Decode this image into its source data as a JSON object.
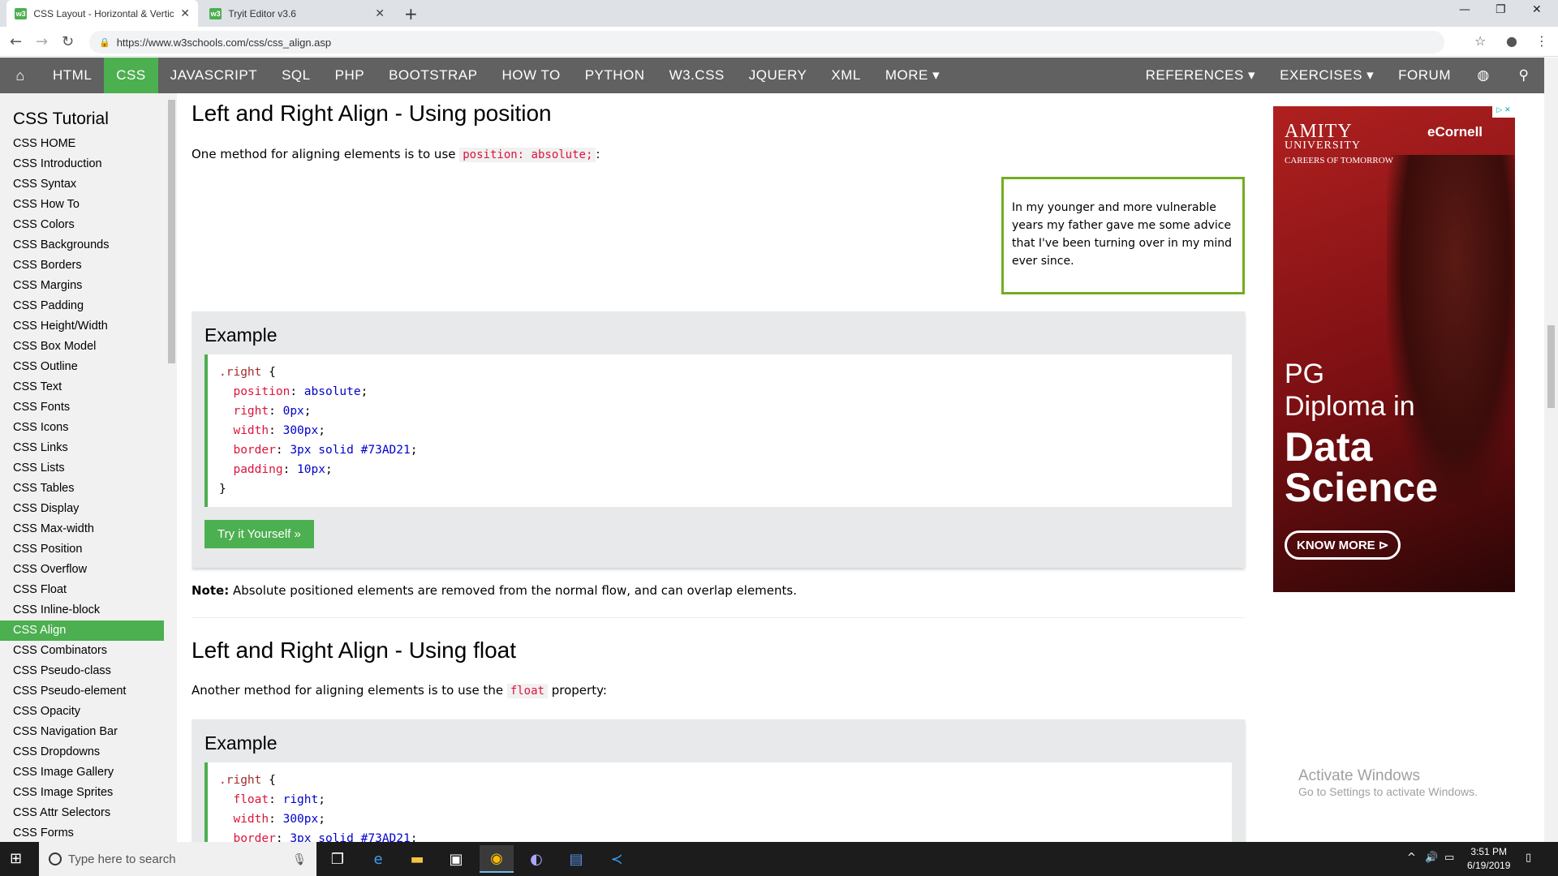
{
  "browser": {
    "tabs": [
      {
        "favicon": "w3",
        "title": "CSS Layout - Horizontal & Vertic",
        "active": true
      },
      {
        "favicon": "w3",
        "title": "Tryit Editor v3.6",
        "active": false
      }
    ],
    "url": "https://www.w3schools.com/css/css_align.asp"
  },
  "topnav": {
    "items": [
      "HTML",
      "CSS",
      "JAVASCRIPT",
      "SQL",
      "PHP",
      "BOOTSTRAP",
      "HOW TO",
      "PYTHON",
      "W3.CSS",
      "JQUERY",
      "XML",
      "MORE ▾"
    ],
    "right_items": [
      "REFERENCES ▾",
      "EXERCISES ▾",
      "FORUM"
    ]
  },
  "sidebar": {
    "title": "CSS Tutorial",
    "items": [
      "CSS HOME",
      "CSS Introduction",
      "CSS Syntax",
      "CSS How To",
      "CSS Colors",
      "CSS Backgrounds",
      "CSS Borders",
      "CSS Margins",
      "CSS Padding",
      "CSS Height/Width",
      "CSS Box Model",
      "CSS Outline",
      "CSS Text",
      "CSS Fonts",
      "CSS Icons",
      "CSS Links",
      "CSS Lists",
      "CSS Tables",
      "CSS Display",
      "CSS Max-width",
      "CSS Position",
      "CSS Overflow",
      "CSS Float",
      "CSS Inline-block",
      "CSS Align",
      "CSS Combinators",
      "CSS Pseudo-class",
      "CSS Pseudo-element",
      "CSS Opacity",
      "CSS Navigation Bar",
      "CSS Dropdowns",
      "CSS Image Gallery",
      "CSS Image Sprites",
      "CSS Attr Selectors",
      "CSS Forms"
    ],
    "active": "CSS Align"
  },
  "main": {
    "section1_title": "Left and Right Align - Using position",
    "section1_intro_before": "One method for aligning elements is to use ",
    "section1_intro_code": "position: absolute;",
    "section1_intro_after": ":",
    "demo_text": "In my younger and more vulnerable years my father gave me some advice that I've been turning over in my mind ever since.",
    "example_heading": "Example",
    "try_button": "Try it Yourself »",
    "note_label": "Note:",
    "note_text": " Absolute positioned elements are removed from the normal flow, and can overlap elements.",
    "section2_title": "Left and Right Align - Using float",
    "section2_intro_before": "Another method for aligning elements is to use the ",
    "section2_intro_code": "float",
    "section2_intro_after": " property:"
  },
  "ad": {
    "university": "AMITY",
    "university_line2": "UNIVERSITY",
    "tagline": "CAREERS OF TOMORROW",
    "partner": "eCornell",
    "line1": "PG",
    "line2": "Diploma in",
    "line3": "Data",
    "line4": "Science",
    "cta": "KNOW MORE"
  },
  "watermark": {
    "title": "Activate Windows",
    "subtitle": "Go to Settings to activate Windows."
  },
  "taskbar": {
    "search_placeholder": "Type here to search",
    "time": "3:51 PM",
    "date": "6/19/2019"
  }
}
